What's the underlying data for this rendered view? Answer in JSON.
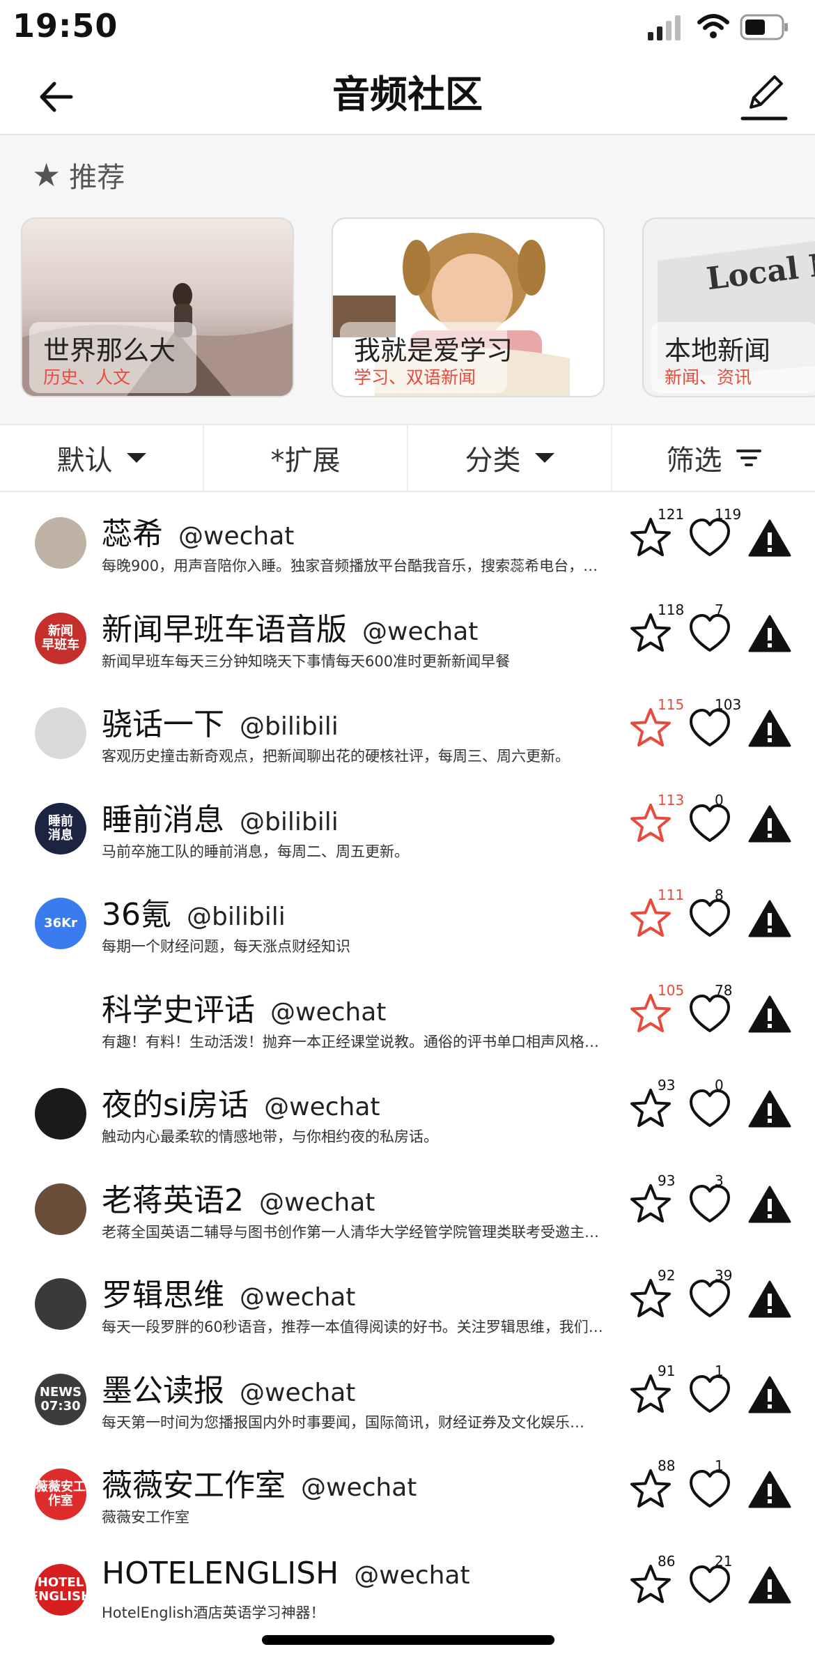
{
  "status": {
    "time": "19:50"
  },
  "nav": {
    "title": "音频社区"
  },
  "recommend": {
    "heading": "推荐",
    "cards": [
      {
        "title": "世界那么大",
        "tags": "历史、人文"
      },
      {
        "title": "我就是爱学习",
        "tags": "学习、双语新闻"
      },
      {
        "title": "本地新闻",
        "tags": "新闻、资讯",
        "image_text": "Local N"
      }
    ]
  },
  "filters": {
    "default": "默认",
    "expand": "*扩展",
    "category": "分类",
    "filter": "筛选"
  },
  "channels": [
    {
      "name": "蕊希",
      "handle": "@wechat",
      "desc": "每晚900，用声音陪你入睡。独家音频播放平台酷我音乐，搜索蕊希电台，每晚…",
      "stars": "121",
      "likes": "119",
      "starred": false,
      "avatar_color": "#bfb2a5",
      "avatar_text": ""
    },
    {
      "name": "新闻早班车语音版",
      "handle": "@wechat",
      "desc": "新闻早班车每天三分钟知晓天下事情每天600准时更新新闻早餐",
      "stars": "118",
      "likes": "7",
      "starred": false,
      "avatar_color": "#c6302c",
      "avatar_text": "新闻\n早班车"
    },
    {
      "name": "骁话一下",
      "handle": "@bilibili",
      "desc": "客观历史撞击新奇观点，把新闻聊出花的硬核社评，每周三、周六更新。",
      "stars": "115",
      "likes": "103",
      "starred": true,
      "avatar_color": "#d9d9d9",
      "avatar_text": ""
    },
    {
      "name": "睡前消息",
      "handle": "@bilibili",
      "desc": "马前卒施工队的睡前消息，每周二、周五更新。",
      "stars": "113",
      "likes": "0",
      "starred": true,
      "avatar_color": "#1b2440",
      "avatar_text": "睡前\n消息"
    },
    {
      "name": "36氪",
      "handle": "@bilibili",
      "desc": "每期一个财经问题，每天涨点财经知识",
      "stars": "111",
      "likes": "8",
      "starred": true,
      "avatar_color": "#3b7bf0",
      "avatar_text": "36Kr"
    },
    {
      "name": "科学史评话",
      "handle": "@wechat",
      "desc": "有趣！有料！生动活泼！抛弃一本正经课堂说教。通俗的评书单口相声风格…",
      "stars": "105",
      "likes": "78",
      "starred": true,
      "avatar_color": "#ffffff",
      "avatar_text": ""
    },
    {
      "name": "夜的si房话",
      "handle": "@wechat",
      "desc": "触动内心最柔软的情感地带，与你相约夜的私房话。",
      "stars": "93",
      "likes": "0",
      "starred": false,
      "avatar_color": "#1a1a1a",
      "avatar_text": ""
    },
    {
      "name": "老蒋英语2",
      "handle": "@wechat",
      "desc": "老蒋全国英语二辅导与图书创作第一人清华大学经管学院管理类联考受邀主…",
      "stars": "93",
      "likes": "3",
      "starred": false,
      "avatar_color": "#6a4e3a",
      "avatar_text": ""
    },
    {
      "name": "罗辑思维",
      "handle": "@wechat",
      "desc": "每天一段罗胖的60秒语音，推荐一本值得阅读的好书。关注罗辑思维，我们…",
      "stars": "92",
      "likes": "39",
      "starred": false,
      "avatar_color": "#3a3a3a",
      "avatar_text": ""
    },
    {
      "name": "墨公读报",
      "handle": "@wechat",
      "desc": "每天第一时间为您播报国内外时事要闻，国际简讯，财经证券及文化娱乐…",
      "stars": "91",
      "likes": "1",
      "starred": false,
      "avatar_color": "#3c3c3c",
      "avatar_text": "NEWS\n07:30"
    },
    {
      "name": "薇薇安工作室",
      "handle": "@wechat",
      "desc": "薇薇安工作室",
      "stars": "88",
      "likes": "1",
      "starred": false,
      "avatar_color": "#de2b2b",
      "avatar_text": "薇薇安工作室"
    },
    {
      "name": "HOTELENGLISH",
      "handle": "@wechat",
      "desc": "HotelEnglish酒店英语学习神器！",
      "stars": "86",
      "likes": "21",
      "starred": false,
      "avatar_color": "#d62020",
      "avatar_text": "HOTEL\nENGLISH"
    }
  ],
  "colors": {
    "accent": "#e84b3c",
    "text": "#111111"
  }
}
